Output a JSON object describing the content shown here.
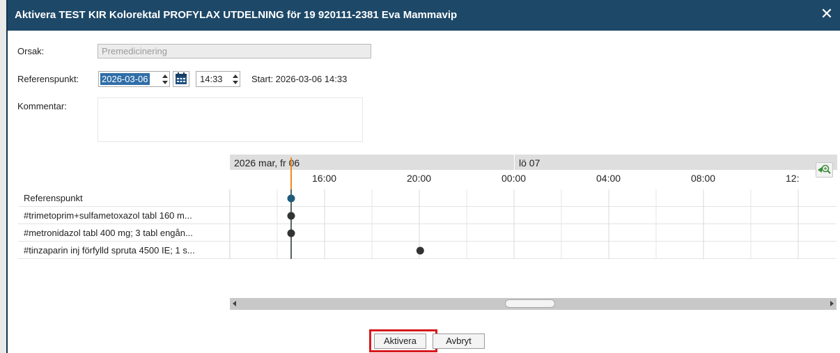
{
  "dialog": {
    "title": "Aktivera TEST KIR Kolorektal PROFYLAX UTDELNING för 19 920111-2381 Eva Mammavip",
    "close_glyph": "✕"
  },
  "form": {
    "orsak_label": "Orsak:",
    "orsak_value": "Premedicinering",
    "referens_label": "Referenspunkt:",
    "date_value": "2026-03-06",
    "time_value": "14:33",
    "start_text": "Start:  2026-03-06 14:33",
    "kommentar_label": "Kommentar:"
  },
  "timeline": {
    "date_header_1": "2026 mar, fr 06",
    "date_header_2": "lö 07",
    "hours": [
      "16:00",
      "20:00",
      "00:00",
      "04:00",
      "08:00",
      "12:"
    ],
    "rows": [
      {
        "label": "Referenspunkt",
        "event_hour_offset": 0,
        "marker": "reference"
      },
      {
        "label": "#trimetoprim+sulfametoxazol tabl 160 m...",
        "event_hour_offset": 0,
        "marker": "dose"
      },
      {
        "label": "#metronidazol tabl 400 mg; 3 tabl engån...",
        "event_hour_offset": 0,
        "marker": "dose"
      },
      {
        "label": "#tinzaparin inj förfylld spruta 4500 IE; 1 s...",
        "event_hour_offset": 5.45,
        "marker": "dose"
      }
    ],
    "colors": {
      "reference_dot": "#1f5b7a",
      "dose_dot": "#333333",
      "now_line": "#f08a1c",
      "ref_line": "#1f5b7a"
    }
  },
  "buttons": {
    "aktivera": "Aktivera",
    "avbryt": "Avbryt"
  },
  "icons": {
    "calendar": "calendar-icon",
    "zoom": "zoom-in-icon",
    "close": "close-icon"
  }
}
